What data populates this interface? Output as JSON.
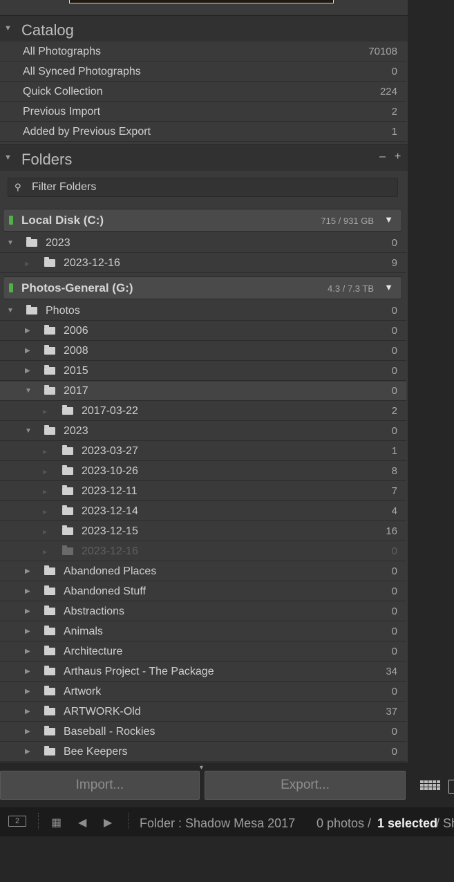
{
  "catalog": {
    "title": "Catalog",
    "items": [
      {
        "label": "All Photographs",
        "count": "70108"
      },
      {
        "label": "All Synced Photographs",
        "count": "0"
      },
      {
        "label": "Quick Collection",
        "count": "224"
      },
      {
        "label": "Previous Import",
        "count": "2"
      },
      {
        "label": "Added by Previous Export",
        "count": "1"
      }
    ]
  },
  "folders": {
    "title": "Folders",
    "minus": "–",
    "plus": "+",
    "filter_placeholder": "Filter Folders",
    "volumes": [
      {
        "name": "Local Disk (C:)",
        "size": "715 / 931 GB"
      },
      {
        "name": "Photos-General (G:)",
        "size": "4.3 / 7.3 TB"
      }
    ],
    "local_items": [
      {
        "label": "2023",
        "count": "0"
      },
      {
        "label": "2023-12-16",
        "count": "9"
      }
    ],
    "general_items": [
      {
        "label": "Photos",
        "count": "0"
      },
      {
        "label": "2006",
        "count": "0"
      },
      {
        "label": "2008",
        "count": "0"
      },
      {
        "label": "2015",
        "count": "0"
      },
      {
        "label": "2017",
        "count": "0"
      },
      {
        "label": "2017-03-22",
        "count": "2"
      },
      {
        "label": "2023",
        "count": "0"
      },
      {
        "label": "2023-03-27",
        "count": "1"
      },
      {
        "label": "2023-10-26",
        "count": "8"
      },
      {
        "label": "2023-12-11",
        "count": "7"
      },
      {
        "label": "2023-12-14",
        "count": "4"
      },
      {
        "label": "2023-12-15",
        "count": "16"
      },
      {
        "label": "2023-12-16",
        "count": "0"
      },
      {
        "label": "Abandoned Places",
        "count": "0"
      },
      {
        "label": "Abandoned Stuff",
        "count": "0"
      },
      {
        "label": "Abstractions",
        "count": "0"
      },
      {
        "label": "Animals",
        "count": "0"
      },
      {
        "label": "Architecture",
        "count": "0"
      },
      {
        "label": "Arthaus Project - The Package",
        "count": "34"
      },
      {
        "label": "Artwork",
        "count": "0"
      },
      {
        "label": "ARTWORK-Old",
        "count": "37"
      },
      {
        "label": "Baseball - Rockies",
        "count": "0"
      },
      {
        "label": "Bee Keepers",
        "count": "0"
      }
    ]
  },
  "buttons": {
    "import": "Import...",
    "export": "Export..."
  },
  "statusbar": {
    "screen_number": "2",
    "folder_text": "Folder : Shadow Mesa 2017",
    "photos_text": "0 photos /",
    "selected_text": "1 selected",
    "trailing_text": "/ Sh"
  },
  "icons": [
    "triangle-down-icon",
    "search-icon",
    "folder-icon",
    "grid-icon",
    "arrow-left-icon",
    "arrow-right-icon"
  ]
}
